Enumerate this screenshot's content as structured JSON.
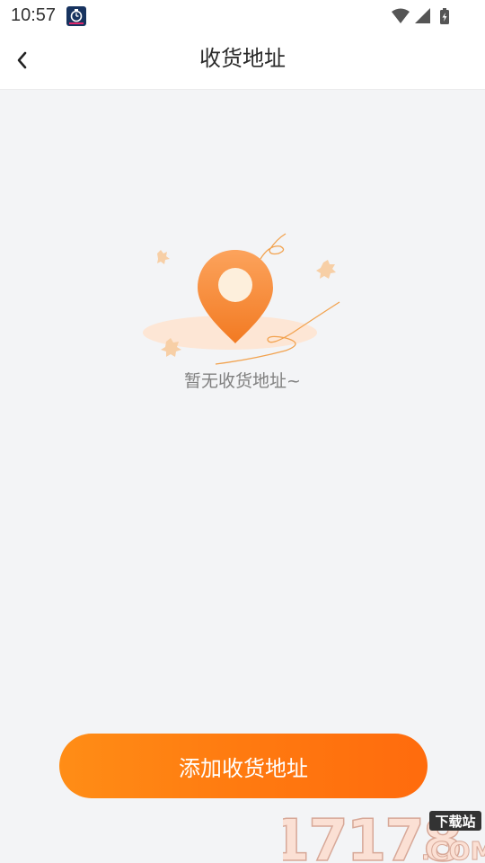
{
  "status_bar": {
    "time": "10:57",
    "icons": [
      "app-notification-icon",
      "wifi-icon",
      "signal-icon",
      "battery-charging-icon"
    ]
  },
  "header": {
    "back_icon": "chevron-left-icon",
    "title": "收货地址"
  },
  "empty_state": {
    "illustration": "location-pin-icon",
    "message": "暂无收货地址~"
  },
  "actions": {
    "add_address_label": "添加收货地址"
  },
  "watermark": {
    "number": "17178",
    "domain": ".COM",
    "badge": "下载站"
  },
  "colors": {
    "accent": "#ff7a10",
    "accent_start": "#ff8d16",
    "accent_end": "#ff6b0d",
    "background": "#f3f4f6"
  }
}
